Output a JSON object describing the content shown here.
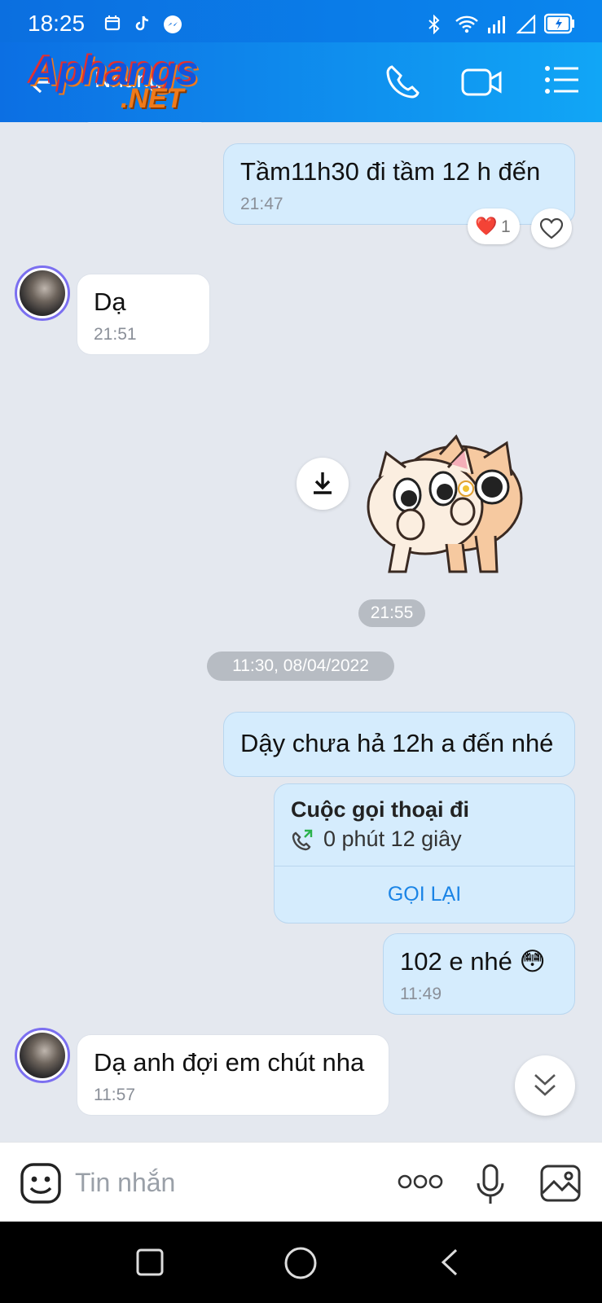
{
  "status_bar": {
    "time": "18:25"
  },
  "header": {
    "contact_name": "Nhung",
    "watermark_top": "Aphangs",
    "watermark_bottom": ".NET"
  },
  "messages": [
    {
      "text": "Tầm11h30 đi tầm 12 h đến",
      "time": "21:47",
      "reaction": "❤️",
      "reaction_count": "1"
    },
    {
      "text": "Dạ",
      "time": "21:51"
    },
    {
      "sticker_time": "21:55"
    },
    {
      "text": "Dậy chưa hả 12h a đến nhé"
    },
    {
      "call_title": "Cuộc gọi thoại đi",
      "call_detail": "0 phút 12 giây",
      "call_back": "GỌI LẠI"
    },
    {
      "text": "102 e nhé",
      "emoji": "😳",
      "time": "11:49"
    },
    {
      "text": "Dạ anh đợi em chút nha",
      "time": "11:57"
    }
  ],
  "date_separator": "11:30, 08/04/2022",
  "input": {
    "placeholder": "Tin nhắn"
  },
  "colors": {
    "header": "#0c6fe3",
    "outgoing_bubble": "#d5ecfd",
    "incoming_bubble": "#ffffff",
    "chat_bg": "#e4e8ef",
    "link": "#1a84e6"
  }
}
